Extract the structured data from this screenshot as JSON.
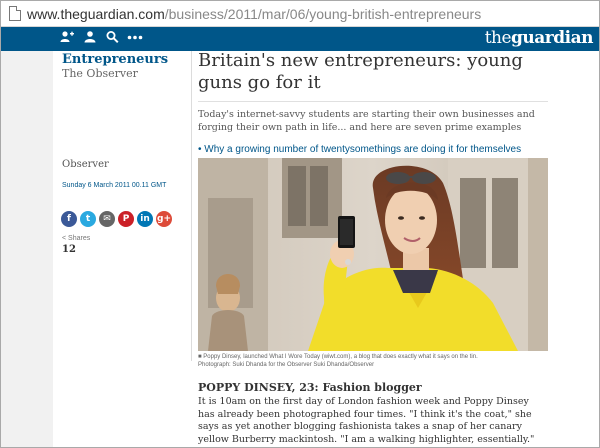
{
  "browser": {
    "url_domain": "www.theguardian.com",
    "url_path": "/business/2011/mar/06/young-british-entrepreneurs"
  },
  "nav": {
    "logo_the": "the",
    "logo_guardian": "guardian",
    "icons": [
      "profile-icon",
      "user-icon",
      "search-icon",
      "more-icon"
    ],
    "bar_color": "#005689"
  },
  "article": {
    "series": "Entrepreneurs",
    "publication": "The Observer",
    "headline": "Britain's new entrepreneurs: young guns go for it",
    "standfirst": "Today's internet-savvy students are starting their own businesses and forging their own path in life... and here are seven prime examples",
    "related_link": "• Why a growing number of twentysomethings are doing it for themselves",
    "byline": "Observer",
    "date": "Sunday 6 March 2011 00.11 GMT",
    "shares_label": "Shares",
    "shares_count": "12",
    "caption_line1": "Poppy Dinsey, launched What I Wore Today (wiwt.com), a blog that does exactly what it says on the tin.",
    "caption_line2": "Photograph: Suki Dhanda for the Observer Suki Dhanda/Observer",
    "subhead": "POPPY DINSEY, 23: Fashion blogger",
    "body": "It is 10am on the first day of London fashion week and Poppy Dinsey has already been photographed four times. \"I think it's the coat,\" she says as yet another blogging fashionista takes a snap of her canary yellow Burberry mackintosh. \"I am a walking highlighter, essentially.\""
  },
  "share_buttons": [
    {
      "name": "facebook",
      "glyph": "f",
      "color": "#3b5998"
    },
    {
      "name": "twitter",
      "glyph": "t",
      "color": "#2aa9e0"
    },
    {
      "name": "email",
      "glyph": "✉",
      "color": "#666666"
    },
    {
      "name": "pinterest",
      "glyph": "P",
      "color": "#cb2027"
    },
    {
      "name": "linkedin",
      "glyph": "in",
      "color": "#0077b5"
    },
    {
      "name": "googleplus",
      "glyph": "g+",
      "color": "#dd4b39"
    }
  ]
}
